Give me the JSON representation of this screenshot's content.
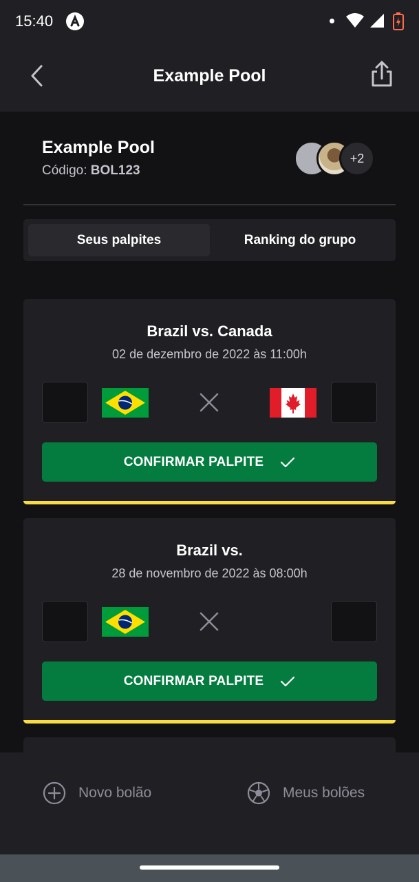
{
  "status_bar": {
    "time": "15:40"
  },
  "header": {
    "title": "Example Pool"
  },
  "pool": {
    "name": "Example Pool",
    "code_label": "Código:",
    "code": "BOL123",
    "extra_participants": "+2"
  },
  "tabs": [
    {
      "label": "Seus palpites",
      "active": true
    },
    {
      "label": "Ranking do grupo",
      "active": false
    }
  ],
  "games": [
    {
      "title": "Brazil vs. Canada",
      "date": "02 de dezembro de 2022 às 11:00h",
      "home_flag": "flag-brazil",
      "away_flag": "flag-canada",
      "home_score": "",
      "away_score": "",
      "button_label": "CONFIRMAR PALPITE"
    },
    {
      "title": "Brazil vs.",
      "date": "28 de novembro de 2022 às 08:00h",
      "home_flag": "flag-brazil",
      "away_flag": "",
      "home_score": "",
      "away_score": "",
      "button_label": "CONFIRMAR PALPITE"
    }
  ],
  "bottom_nav": {
    "new_pool": "Novo bolão",
    "my_pools": "Meus bolões"
  },
  "colors": {
    "background": "#121214",
    "surface": "#202024",
    "primary_green": "#047c3f",
    "accent_yellow": "#f7dd43",
    "muted_text": "#c4c4cc"
  }
}
